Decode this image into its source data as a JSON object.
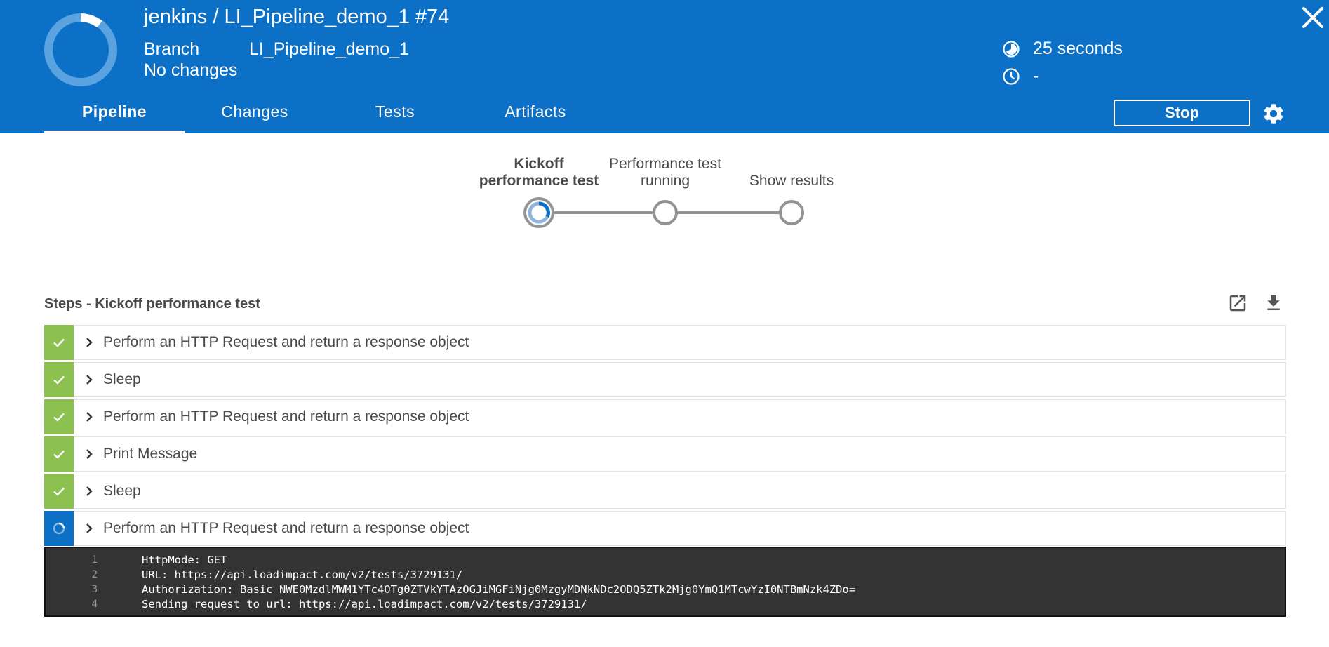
{
  "header": {
    "title": "jenkins / LI_Pipeline_demo_1 #74",
    "branch_label": "Branch",
    "branch_value": "LI_Pipeline_demo_1",
    "changes": "No changes",
    "duration": "25 seconds",
    "finished": "-",
    "status_icon": "running-ring-icon",
    "colors": {
      "header_bg": "#0b70c6",
      "success": "#8cc04f",
      "running": "#0b70c6"
    }
  },
  "tabs": [
    {
      "label": "Pipeline",
      "active": true
    },
    {
      "label": "Changes",
      "active": false
    },
    {
      "label": "Tests",
      "active": false
    },
    {
      "label": "Artifacts",
      "active": false
    }
  ],
  "actions": {
    "stop_label": "Stop"
  },
  "graph": {
    "stages": [
      {
        "line1": "Kickoff",
        "line2": "performance test",
        "state": "running"
      },
      {
        "line1": "Performance test",
        "line2": "running",
        "state": "queued"
      },
      {
        "line1": "",
        "line2": "Show results",
        "state": "queued"
      }
    ]
  },
  "steps_section": {
    "title": "Steps - Kickoff performance test",
    "steps": [
      {
        "label": "Perform an HTTP Request and return a response object",
        "status": "success"
      },
      {
        "label": "Sleep",
        "status": "success"
      },
      {
        "label": "Perform an HTTP Request and return a response object",
        "status": "success"
      },
      {
        "label": "Print Message",
        "status": "success"
      },
      {
        "label": "Sleep",
        "status": "success"
      },
      {
        "label": "Perform an HTTP Request and return a response object",
        "status": "running"
      }
    ]
  },
  "log": [
    {
      "num": "1",
      "text": "HttpMode: GET"
    },
    {
      "num": "2",
      "text": "URL: https://api.loadimpact.com/v2/tests/3729131/"
    },
    {
      "num": "3",
      "text": "Authorization: Basic NWE0MzdlMWM1YTc4OTg0ZTVkYTAzOGJiMGFiNjg0MzgyMDNkNDc2ODQ5ZTk2Mjg0YmQ1MTcwYzI0NTBmNzk4ZDo="
    },
    {
      "num": "4",
      "text": "Sending request to url: https://api.loadimpact.com/v2/tests/3729131/"
    }
  ]
}
